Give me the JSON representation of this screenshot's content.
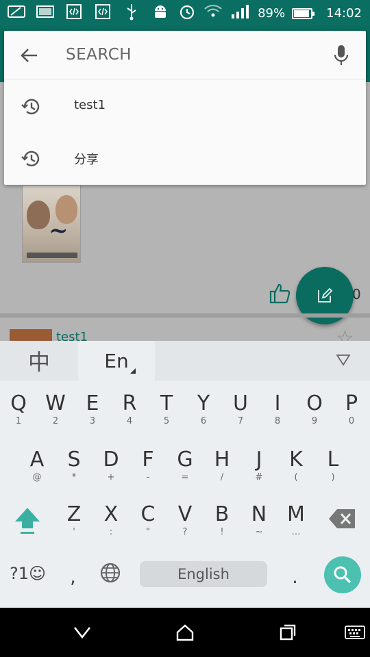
{
  "status_bar": {
    "battery": "89%",
    "battery_level": 0.89,
    "time": "14:02",
    "left_icons": [
      "sms-icon",
      "image-icon",
      "code-icon",
      "code-icon",
      "usb-icon",
      "android-icon"
    ],
    "right_icons": [
      "alarm-icon",
      "wifi-icon",
      "signal-icon",
      "battery-charging-icon"
    ]
  },
  "search": {
    "placeholder": "SEARCH",
    "value": "",
    "history": [
      "test1",
      "分享"
    ]
  },
  "feed": {
    "second_item_title": "test1",
    "like_count": "0"
  },
  "keyboard": {
    "lang_zh": "中",
    "lang_en": "En",
    "row1": [
      {
        "main": "Q",
        "sub": "1"
      },
      {
        "main": "W",
        "sub": "2"
      },
      {
        "main": "E",
        "sub": "3"
      },
      {
        "main": "R",
        "sub": "4"
      },
      {
        "main": "T",
        "sub": "5"
      },
      {
        "main": "Y",
        "sub": "6"
      },
      {
        "main": "U",
        "sub": "7"
      },
      {
        "main": "I",
        "sub": "8"
      },
      {
        "main": "O",
        "sub": "9"
      },
      {
        "main": "P",
        "sub": "0"
      }
    ],
    "row2": [
      {
        "main": "A",
        "sub": "@"
      },
      {
        "main": "S",
        "sub": "*"
      },
      {
        "main": "D",
        "sub": "+"
      },
      {
        "main": "F",
        "sub": "-"
      },
      {
        "main": "G",
        "sub": "="
      },
      {
        "main": "H",
        "sub": "/"
      },
      {
        "main": "J",
        "sub": "#"
      },
      {
        "main": "K",
        "sub": "("
      },
      {
        "main": "L",
        "sub": ")"
      }
    ],
    "row3": [
      {
        "main": "Z",
        "sub": "'"
      },
      {
        "main": "X",
        "sub": ":"
      },
      {
        "main": "C",
        "sub": "\""
      },
      {
        "main": "V",
        "sub": "?"
      },
      {
        "main": "B",
        "sub": "!"
      },
      {
        "main": "N",
        "sub": "~"
      },
      {
        "main": "M",
        "sub": "…"
      }
    ],
    "symbols_label": "?1☺",
    "comma": ",",
    "space_label": "English",
    "period": "."
  },
  "colors": {
    "primary": "#0a6b5f",
    "status_bar": "#0b6e62",
    "search_key": "#4cc0b1",
    "shift": "#3bb0a2"
  }
}
